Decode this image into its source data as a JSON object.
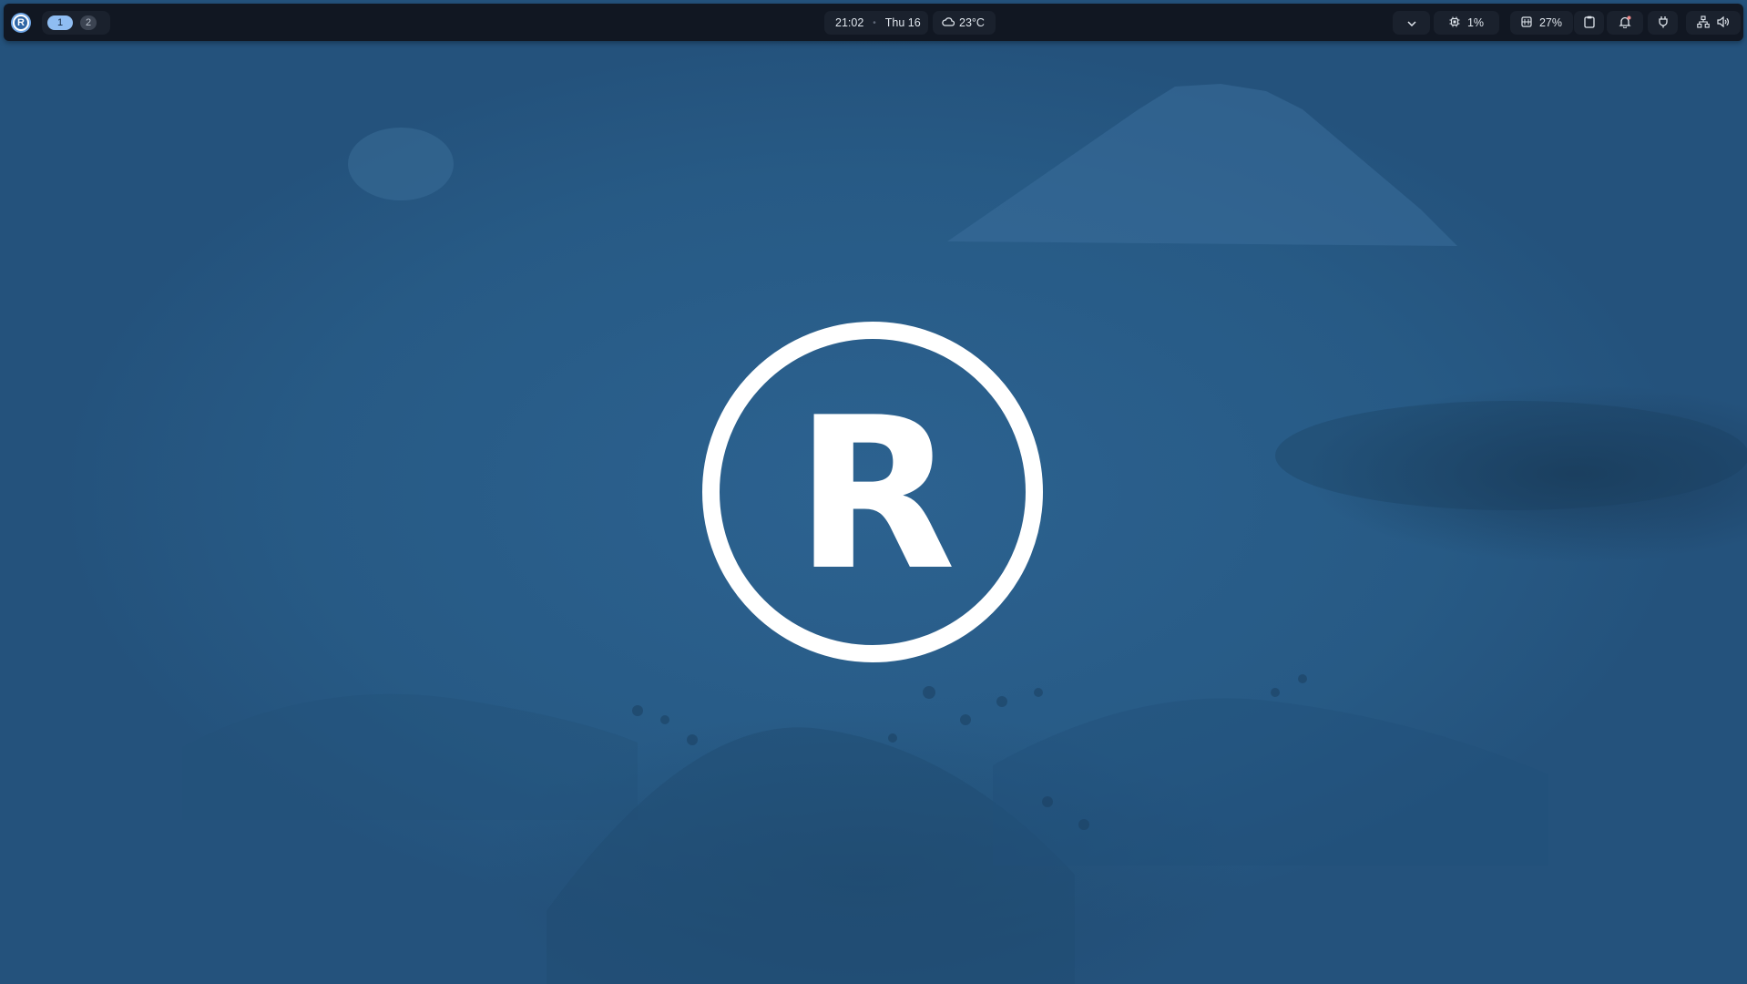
{
  "desktop": {
    "wallpaper_color": "#285b87",
    "center_logo_letter": "R"
  },
  "topbar": {
    "launcher_letter": "R",
    "workspaces": [
      {
        "label": "1",
        "active": true
      },
      {
        "label": "2",
        "active": false
      }
    ],
    "clock": {
      "time": "21:02",
      "separator": "•",
      "date": "Thu 16"
    },
    "weather": {
      "icon": "cloud-icon",
      "temperature": "23°C"
    },
    "tray": {
      "expand_icon": "chevron-down-icon",
      "cpu": {
        "icon": "cpu-icon",
        "value": "1%"
      },
      "memory": {
        "icon": "memory-icon",
        "value": "27%"
      },
      "clipboard_icon": "clipboard-icon",
      "notifications_icon": "bell-icon",
      "power_icon": "plug-icon",
      "network_icon": "network-icon",
      "volume_icon": "volume-icon"
    }
  }
}
